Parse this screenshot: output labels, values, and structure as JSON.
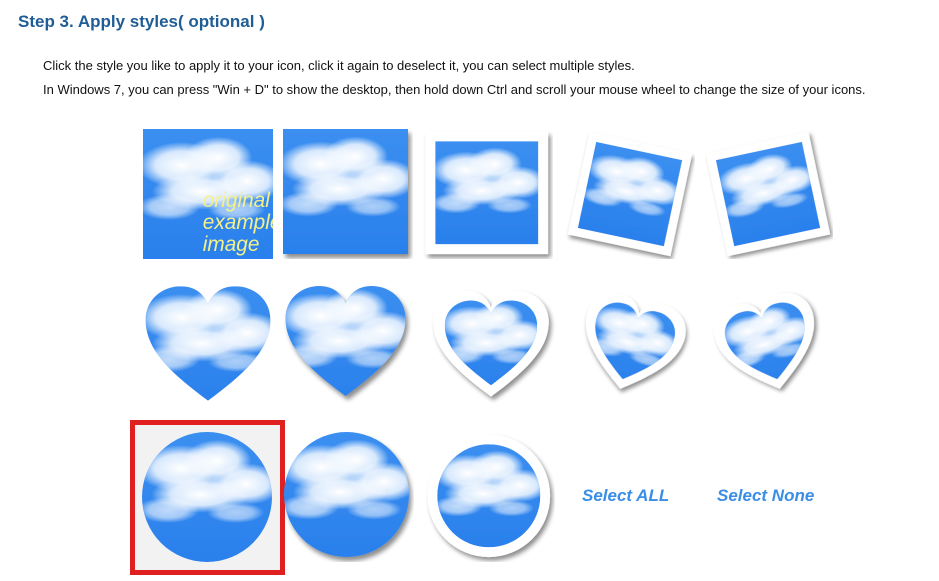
{
  "step_title": "Step 3. Apply styles( optional )",
  "instructions": {
    "line1": "Click the style you like to apply it to your icon, click it again to deselect it, you can select multiple styles.",
    "line2": "In Windows 7, you can press \"Win + D\" to show the desktop, then hold down Ctrl and scroll your mouse wheel to change the size of your icons."
  },
  "styles": [
    {
      "shape": "square",
      "variant": "original",
      "caption": [
        "original",
        "example",
        "image"
      ],
      "selected": false
    },
    {
      "shape": "square",
      "variant": "shadow",
      "selected": false
    },
    {
      "shape": "square",
      "variant": "frame",
      "selected": false
    },
    {
      "shape": "square",
      "variant": "frame-rotated-left",
      "selected": false
    },
    {
      "shape": "square",
      "variant": "frame-rotated-right",
      "selected": false
    },
    {
      "shape": "heart",
      "variant": "plain",
      "selected": false
    },
    {
      "shape": "heart",
      "variant": "shadow",
      "selected": false
    },
    {
      "shape": "heart",
      "variant": "frame",
      "selected": false
    },
    {
      "shape": "heart",
      "variant": "frame-rotated-left",
      "selected": false
    },
    {
      "shape": "heart",
      "variant": "frame-rotated-right",
      "selected": false
    },
    {
      "shape": "circle",
      "variant": "plain",
      "selected": true
    },
    {
      "shape": "circle",
      "variant": "shadow",
      "selected": false
    },
    {
      "shape": "circle",
      "variant": "frame",
      "selected": false
    }
  ],
  "actions": {
    "select_all": "Select ALL",
    "select_none": "Select None"
  },
  "colors": {
    "title": "#1f5d96",
    "sky": "#2f86ee",
    "link": "#3a8ee6",
    "selection_border": "#e02020"
  }
}
